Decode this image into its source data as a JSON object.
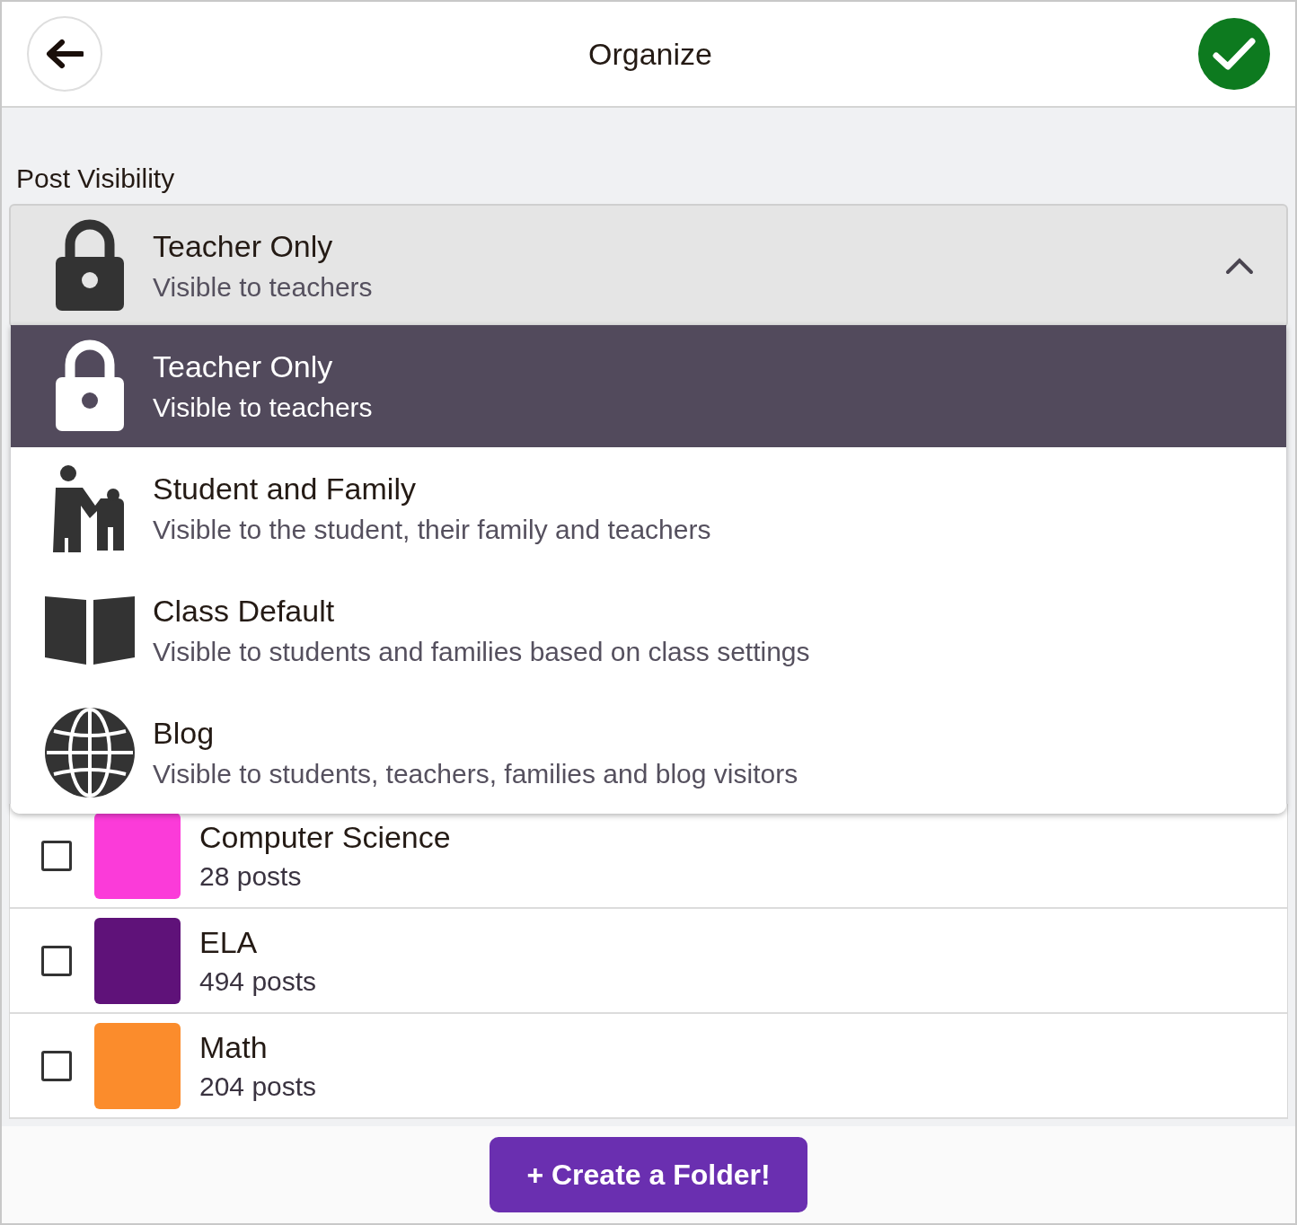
{
  "header": {
    "title": "Organize"
  },
  "visibility": {
    "label": "Post Visibility",
    "expanded": true,
    "current": {
      "kind": "lock",
      "title": "Teacher Only",
      "subtitle": "Visible to teachers"
    },
    "options": [
      {
        "kind": "lock",
        "title": "Teacher Only",
        "subtitle": "Visible to teachers",
        "selected": true
      },
      {
        "kind": "family",
        "title": "Student and Family",
        "subtitle": "Visible to the student, their family and teachers",
        "selected": false
      },
      {
        "kind": "book",
        "title": "Class Default",
        "subtitle": "Visible to students and families based on class settings",
        "selected": false
      },
      {
        "kind": "globe",
        "title": "Blog",
        "subtitle": "Visible to students, teachers, families and blog visitors",
        "selected": false
      }
    ]
  },
  "folders": [
    {
      "name": "Computer Science",
      "count": "28 posts",
      "color": "#fb3bd9",
      "checked": false
    },
    {
      "name": "ELA",
      "count": "494 posts",
      "color": "#5f1279",
      "checked": false
    },
    {
      "name": "Math",
      "count": "204 posts",
      "color": "#fb8c2c",
      "checked": false
    }
  ],
  "create_button": "+ Create a Folder!"
}
